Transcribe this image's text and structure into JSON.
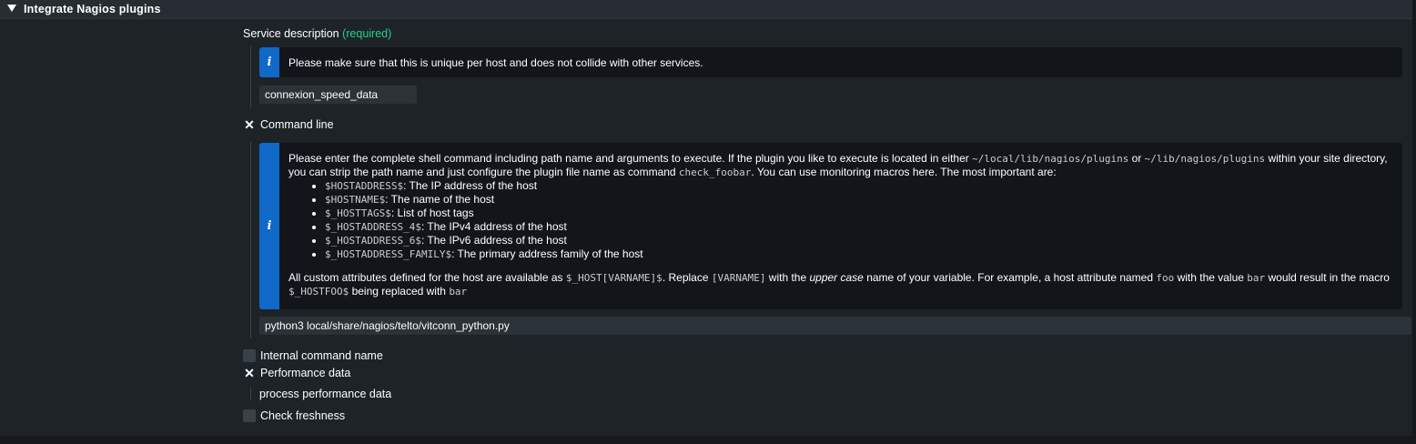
{
  "section": {
    "title": "Integrate Nagios plugins"
  },
  "service_description": {
    "label": "Service description",
    "required": "(required)",
    "info_icon": "info-icon",
    "info": "Please make sure that this is unique per host and does not collide with other services.",
    "value": "connexion_speed_data"
  },
  "command_line": {
    "label": "Command line",
    "checked": true,
    "info_icon": "info-icon",
    "info": {
      "p1_a": "Please enter the complete shell command including path name and arguments to execute. If the plugin you like to execute is located in either ",
      "p1_code1": "~/local/lib/nagios/plugins",
      "p1_b": " or ",
      "p1_code2": "~/lib/nagios/plugins",
      "p1_c": " within your site directory, you can strip the path name and just configure the plugin file name as command ",
      "p1_code3": "check_foobar",
      "p1_d": ". You can use monitoring macros here. The most important are:",
      "macros": [
        {
          "code": "$HOSTADDRESS$",
          "desc": ": The IP address of the host"
        },
        {
          "code": "$HOSTNAME$",
          "desc": ": The name of the host"
        },
        {
          "code": "$_HOSTTAGS$",
          "desc": ": List of host tags"
        },
        {
          "code": "$_HOSTADDRESS_4$",
          "desc": ": The IPv4 address of the host"
        },
        {
          "code": "$_HOSTADDRESS_6$",
          "desc": ": The IPv6 address of the host"
        },
        {
          "code": "$_HOSTADDRESS_FAMILY$",
          "desc": ": The primary address family of the host"
        }
      ],
      "p2_a": "All custom attributes defined for the host are available as ",
      "p2_code1": "$_HOST[VARNAME]$",
      "p2_b": ". Replace ",
      "p2_code2": "[VARNAME]",
      "p2_c": " with the ",
      "p2_em": "upper case",
      "p2_d": " name of your variable. For example, a host attribute named ",
      "p2_code3": "foo",
      "p2_e": " with the value ",
      "p2_code4": "bar",
      "p2_f": " would result in the macro ",
      "p2_code5": "$_HOSTFOO$",
      "p2_g": " being replaced with ",
      "p2_code6": "bar"
    },
    "value": "python3 local/share/nagios/telto/vitconn_python.py"
  },
  "internal_command_name": {
    "label": "Internal command name",
    "checked": false
  },
  "performance_data": {
    "label": "Performance data",
    "checked": true,
    "sub_label": "process performance data"
  },
  "check_freshness": {
    "label": "Check freshness",
    "checked": false
  }
}
